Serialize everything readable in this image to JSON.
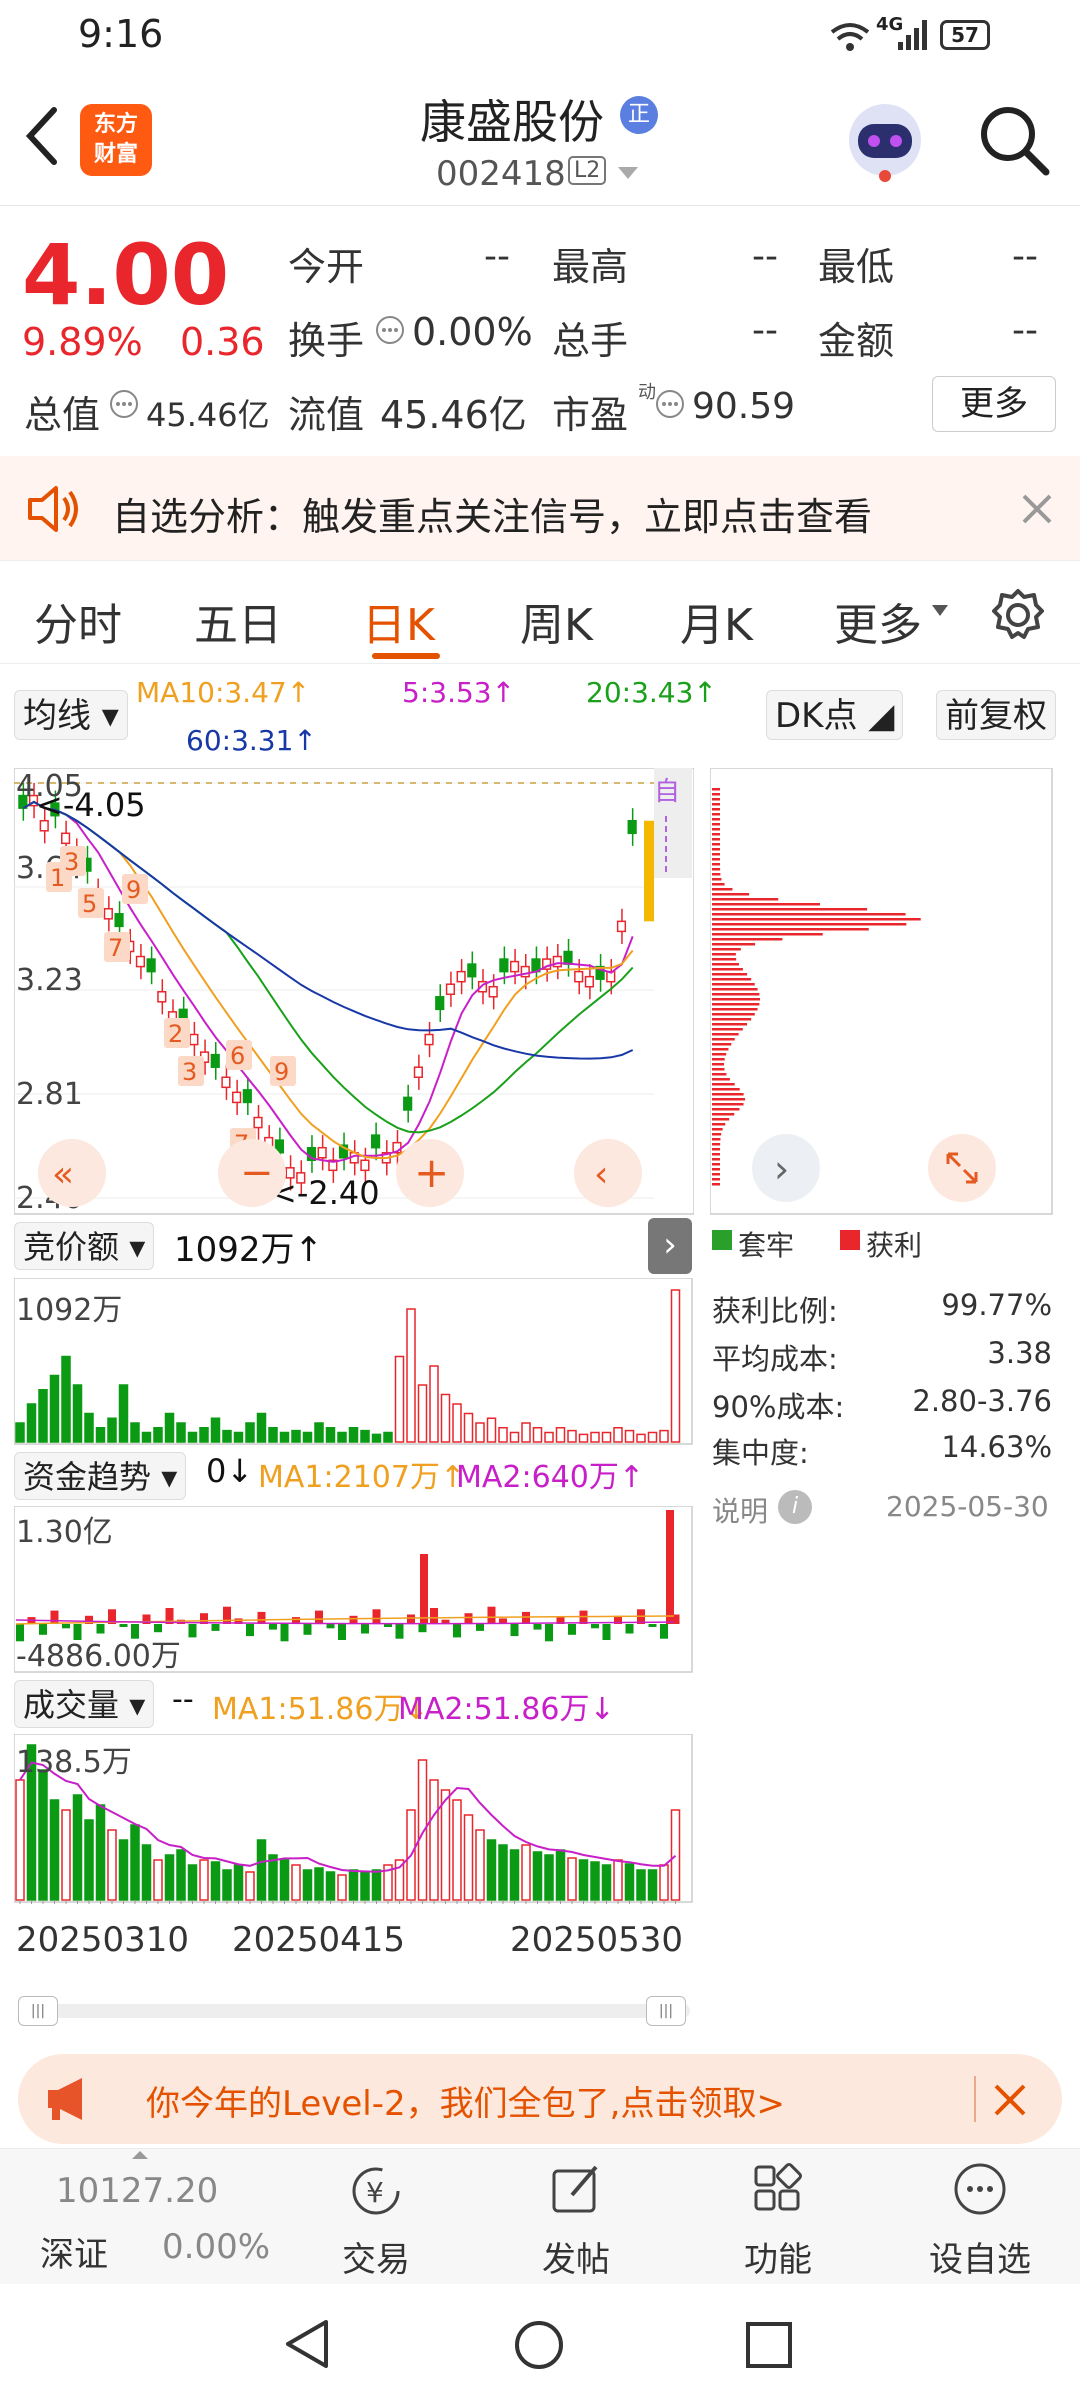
{
  "status": {
    "time": "9:16",
    "network": "4G",
    "battery": "57"
  },
  "header": {
    "logo_line1": "东方",
    "logo_line2": "财富",
    "stock_name": "康盛股份",
    "badge": "正",
    "stock_code": "002418",
    "level_tag": "L2"
  },
  "quote": {
    "price": "4.00",
    "change_pct": "9.89%",
    "change_abs": "0.36",
    "fields": {
      "open_label": "今开",
      "open_value": "--",
      "high_label": "最高",
      "high_value": "--",
      "low_label": "最低",
      "low_value": "--",
      "turnover_label": "换手",
      "turnover_value": "0.00%",
      "volume_label": "总手",
      "volume_value": "--",
      "amount_label": "金额",
      "amount_value": "--",
      "mktcap_label": "总值",
      "mktcap_value": "45.46亿",
      "float_label": "流值",
      "float_value": "45.46亿",
      "pe_label": "市盈",
      "pe_sup": "动",
      "pe_value": "90.59"
    },
    "more_button": "更多"
  },
  "notice": {
    "text": "自选分析：触发重点关注信号，立即点击查看"
  },
  "tabs": [
    "分时",
    "五日",
    "日K",
    "周K",
    "月K",
    "更多"
  ],
  "active_tab": "日K",
  "chart_toolbar": {
    "ma_select": "均线",
    "ma10": "MA10:3.47↑",
    "ma5": "5:3.53↑",
    "ma20": "20:3.43↑",
    "ma60": "60:3.31↑",
    "dk_button": "DK点",
    "adjust_button": "前复权"
  },
  "kline": {
    "y_top": "4.05",
    "y_2": "3.64",
    "y_3": "3.23",
    "y_4": "2.81",
    "y_bottom": "2.40",
    "high_marker": "<-4.05",
    "low_marker": "<-2.40",
    "self_tag": "自"
  },
  "auction": {
    "select": "竞价额",
    "value": "1092万↑",
    "axis_top": "1092万"
  },
  "fund_trend": {
    "select": "资金趋势",
    "value": "0↓",
    "ma1": "MA1:2107万↑",
    "ma2": "MA2:640万↑",
    "axis_top": "1.30亿",
    "axis_bottom": "-4886.00万"
  },
  "volume": {
    "select": "成交量",
    "value": "--",
    "ma1": "MA1:51.86万↓",
    "ma2": "MA2:51.86万↓",
    "axis_top": "138.5万"
  },
  "x_axis": {
    "d1": "20250310",
    "d2": "20250415",
    "d3": "20250530"
  },
  "chip": {
    "legend_trapped": "套牢",
    "legend_profit": "获利",
    "rows": [
      {
        "label": "获利比例:",
        "value": "99.77%"
      },
      {
        "label": "平均成本:",
        "value": "3.38"
      },
      {
        "label": "90%成本:",
        "value": "2.80-3.76"
      },
      {
        "label": "集中度:",
        "value": "14.63%"
      }
    ],
    "explain": "说明",
    "date": "2025-05-30"
  },
  "banner": {
    "text": "你今年的Level-2，我们全包了,点击领取>"
  },
  "bottom_nav": {
    "index_value": "10127.20",
    "index_name": "深证",
    "index_change": "0.00%",
    "trade": "交易",
    "post": "发帖",
    "function": "功能",
    "add_watch": "设自选"
  },
  "colors": {
    "up": "#e8262c",
    "down": "#0a9a14",
    "accent": "#e45200",
    "ma5": "#c820c8",
    "ma10": "#f0a020",
    "ma20": "#1aa01a",
    "ma60": "#1838a8"
  }
}
